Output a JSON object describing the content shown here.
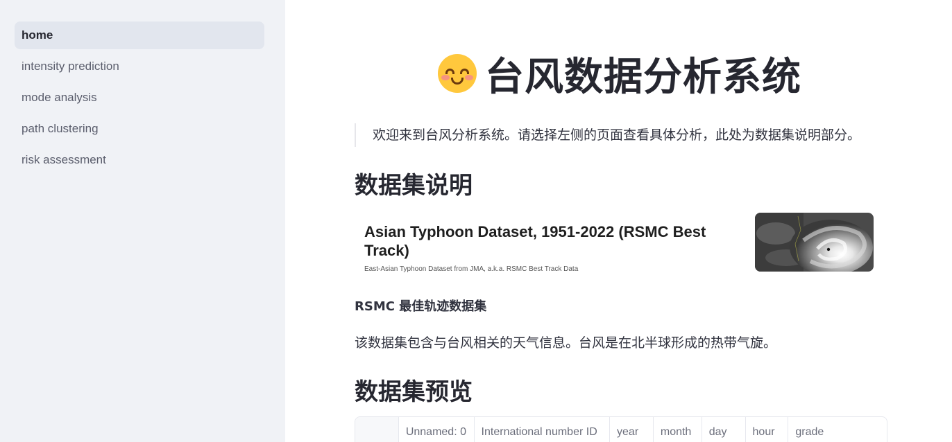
{
  "sidebar": {
    "items": [
      {
        "label": "home",
        "active": true
      },
      {
        "label": "intensity prediction",
        "active": false
      },
      {
        "label": "mode analysis",
        "active": false
      },
      {
        "label": "path clustering",
        "active": false
      },
      {
        "label": "risk assessment",
        "active": false
      }
    ]
  },
  "main": {
    "title_icon": "smiling-face-emoji",
    "title": "台风数据分析系统",
    "intro": "欢迎来到台风分析系统。请选择左侧的页面查看具体分析，此处为数据集说明部分。",
    "section1_heading": "数据集说明",
    "dataset_card": {
      "title": "Asian Typhoon Dataset, 1951-2022 (RSMC Best Track)",
      "subtitle": "East-Asian Typhoon Dataset from JMA, a.k.a. RSMC Best Track Data",
      "thumbnail": "typhoon-satellite-image"
    },
    "bold_line": "RSMC 最佳轨迹数据集",
    "description": "该数据集包含与台风相关的天气信息。台风是在北半球形成的热带气旋。",
    "section2_heading": "数据集预览",
    "table": {
      "columns": [
        "",
        "Unnamed: 0",
        "International number ID",
        "year",
        "month",
        "day",
        "hour",
        "grade"
      ]
    }
  }
}
